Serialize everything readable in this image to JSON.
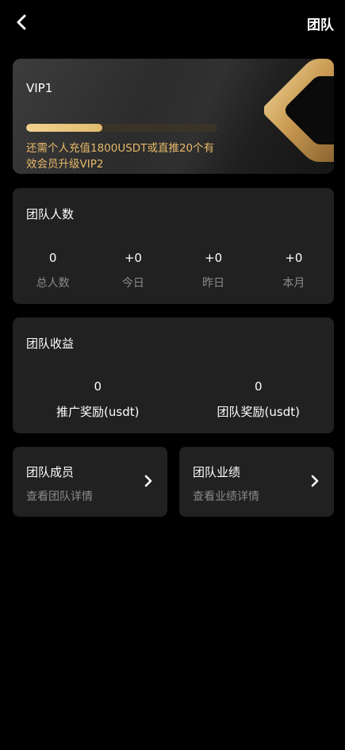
{
  "header": {
    "title": "团队",
    "back_icon": "chevron-left-icon"
  },
  "vip": {
    "level": "VIP1",
    "progress_fraction": 0.4,
    "note": "还需个人充值1800USDT或直推20个有效会员升级VIP2",
    "accent_color": "#e8b96a"
  },
  "team_count": {
    "title": "团队人数",
    "stats": [
      {
        "value": "0",
        "label": "总人数"
      },
      {
        "value": "+0",
        "label": "今日"
      },
      {
        "value": "+0",
        "label": "昨日"
      },
      {
        "value": "+0",
        "label": "本月"
      }
    ]
  },
  "team_income": {
    "title": "团队收益",
    "stats": [
      {
        "value": "0",
        "label": "推广奖励(usdt)"
      },
      {
        "value": "0",
        "label": "团队奖励(usdt)"
      }
    ]
  },
  "links": [
    {
      "title": "团队成员",
      "subtitle": "查看团队详情",
      "icon": "chevron-right-icon"
    },
    {
      "title": "团队业绩",
      "subtitle": "查看业绩详情",
      "icon": "chevron-right-icon"
    }
  ]
}
